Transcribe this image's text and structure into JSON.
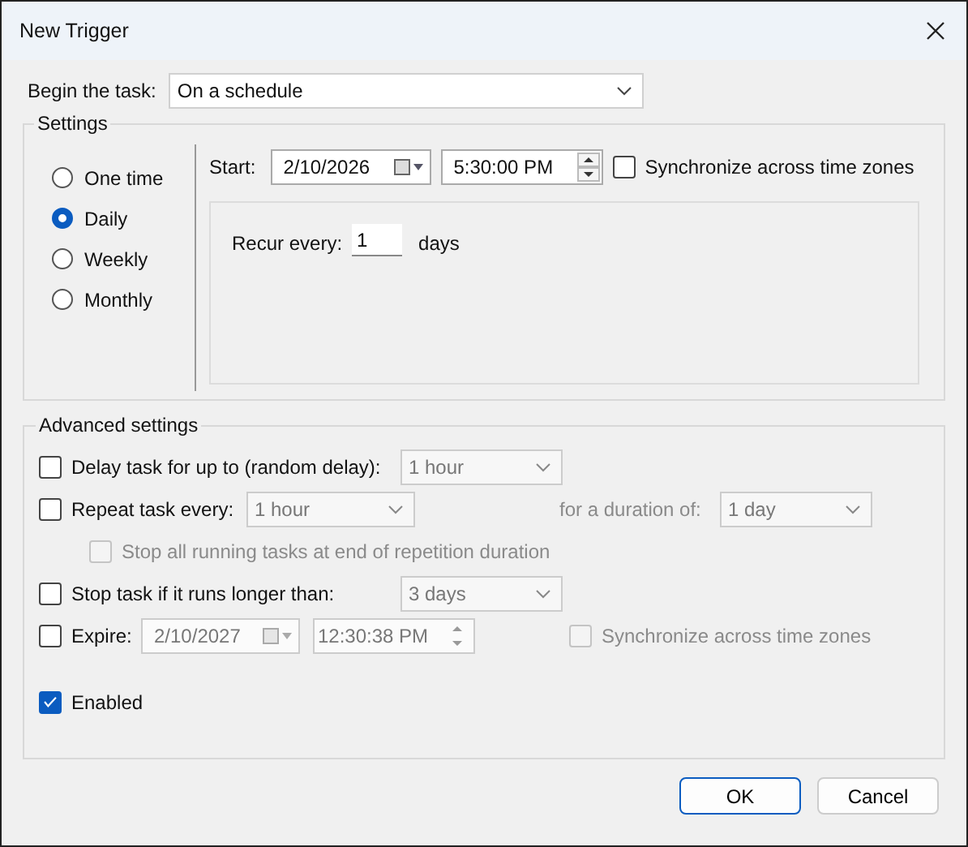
{
  "window": {
    "title": "New Trigger"
  },
  "begin": {
    "label": "Begin the task:",
    "value": "On a schedule"
  },
  "settings": {
    "title": "Settings",
    "schedules": [
      {
        "label": "One time",
        "selected": false
      },
      {
        "label": "Daily",
        "selected": true
      },
      {
        "label": "Weekly",
        "selected": false
      },
      {
        "label": "Monthly",
        "selected": false
      }
    ],
    "start": {
      "label": "Start:",
      "date": "2/10/2026",
      "time": "5:30:00 PM"
    },
    "sync": {
      "label": "Synchronize across time zones",
      "checked": false
    },
    "recur": {
      "label": "Recur every:",
      "value": "1",
      "unit": "days"
    }
  },
  "advanced": {
    "title": "Advanced settings",
    "delay": {
      "label": "Delay task for up to (random delay):",
      "checked": false,
      "value": "1 hour",
      "disabled": true
    },
    "repeat": {
      "label": "Repeat task every:",
      "checked": false,
      "value": "1 hour",
      "duration_label": "for a duration of:",
      "duration": "1 day",
      "disabled": true
    },
    "stop_all": {
      "label": "Stop all running tasks at end of repetition duration",
      "checked": false,
      "disabled": true
    },
    "stop_task": {
      "label": "Stop task if it runs longer than:",
      "checked": false,
      "value": "3 days",
      "disabled": true
    },
    "expire": {
      "label": "Expire:",
      "checked": false,
      "date": "2/10/2027",
      "time": "12:30:38 PM",
      "disabled": true
    },
    "expire_sync": {
      "label": "Synchronize across time zones",
      "checked": false,
      "disabled": true
    },
    "enabled": {
      "label": "Enabled",
      "checked": true
    }
  },
  "buttons": [
    {
      "label": "OK",
      "default": true
    },
    {
      "label": "Cancel",
      "default": false
    }
  ]
}
